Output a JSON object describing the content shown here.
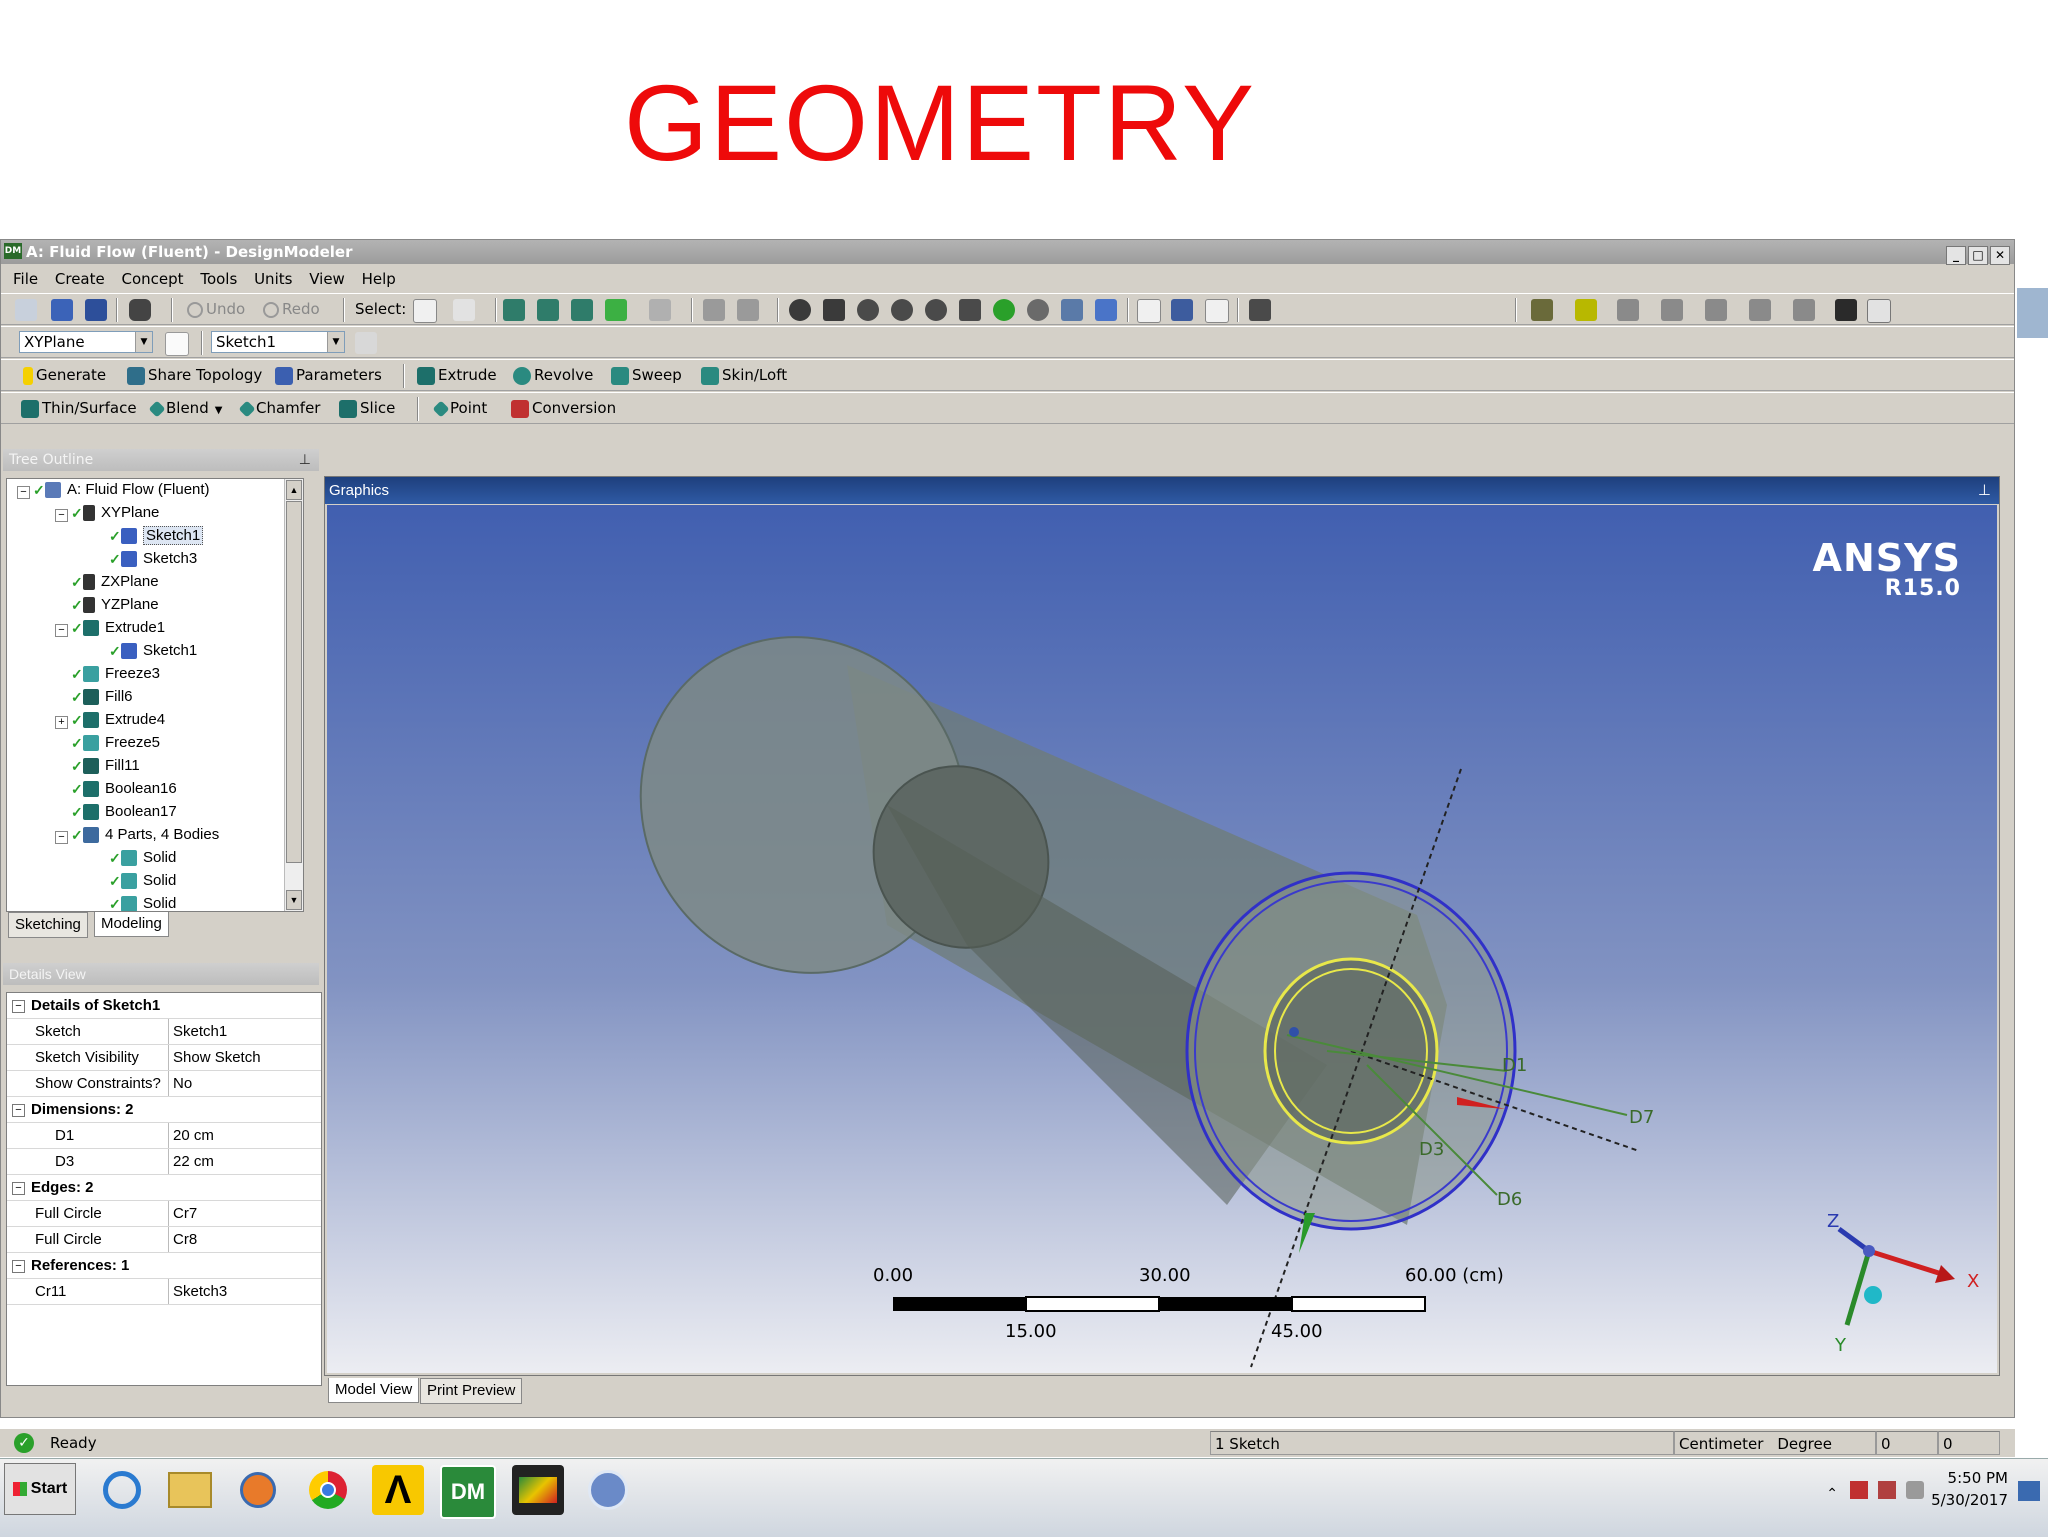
{
  "slide": {
    "title": "GEOMETRY"
  },
  "window": {
    "title": "A: Fluid Flow (Fluent) - DesignModeler",
    "app_icon": "DM",
    "min": "_",
    "max": "□",
    "close": "✕"
  },
  "menu": [
    "File",
    "Create",
    "Concept",
    "Tools",
    "Units",
    "View",
    "Help"
  ],
  "toolbar1": {
    "undo": "Undo",
    "redo": "Redo",
    "select": "Select:"
  },
  "toolbar2": {
    "plane": "XYPlane",
    "sketch": "Sketch1"
  },
  "toolbar3": [
    "Generate",
    "Share Topology",
    "Parameters",
    "Extrude",
    "Revolve",
    "Sweep",
    "Skin/Loft"
  ],
  "toolbar4": [
    "Thin/Surface",
    "Blend",
    "Chamfer",
    "Slice",
    "Point",
    "Conversion"
  ],
  "tree": {
    "header": "Tree Outline",
    "pin": "⊥",
    "items": [
      "A: Fluid Flow (Fluent)",
      "XYPlane",
      "Sketch1",
      "Sketch3",
      "ZXPlane",
      "YZPlane",
      "Extrude1",
      "Sketch1",
      "Freeze3",
      "Fill6",
      "Extrude4",
      "Freeze5",
      "Fill11",
      "Boolean16",
      "Boolean17",
      "4 Parts, 4 Bodies",
      "Solid",
      "Solid",
      "Solid"
    ],
    "tabs": [
      "Sketching",
      "Modeling"
    ]
  },
  "details": {
    "header": "Details View",
    "rows": [
      {
        "group": "Details of Sketch1"
      },
      {
        "k": "Sketch",
        "v": "Sketch1"
      },
      {
        "k": "Sketch Visibility",
        "v": "Show Sketch"
      },
      {
        "k": "Show Constraints?",
        "v": "No"
      },
      {
        "group": "Dimensions: 2"
      },
      {
        "k": "D1",
        "v": "20 cm"
      },
      {
        "k": "D3",
        "v": "22 cm"
      },
      {
        "group": "Edges: 2"
      },
      {
        "k": "Full Circle",
        "v": "Cr7"
      },
      {
        "k": "Full Circle",
        "v": "Cr8"
      },
      {
        "group": "References: 1"
      },
      {
        "k": "Cr11",
        "v": "Sketch3"
      }
    ]
  },
  "graphics": {
    "header": "Graphics",
    "pin": "⊥",
    "brand": "ANSYS",
    "version": "R15.0",
    "dim_labels": {
      "d1": "D1",
      "d3": "D3",
      "d6": "D6",
      "d7": "D7"
    },
    "scale": {
      "t0": "0.00",
      "t15": "15.00",
      "t30": "30.00",
      "t45": "45.00",
      "t60": "60.00 (cm)"
    },
    "axes": {
      "x": "X",
      "y": "Y",
      "z": "Z"
    },
    "tabs": [
      "Model View",
      "Print Preview"
    ]
  },
  "status": {
    "text": "Ready",
    "selection": "1 Sketch",
    "length_unit": "Centimeter",
    "angle_unit": "Degree",
    "v1": "0",
    "v2": "0"
  },
  "taskbar": {
    "start": "Start",
    "time": "5:50 PM",
    "date": "5/30/2017",
    "dm": "DM"
  },
  "colors": {
    "title_red": "#ee0a0a",
    "gfx_header": "#2f5aa5",
    "sketch_yellow": "#e8e84a",
    "circle_blue": "#3030c8"
  }
}
